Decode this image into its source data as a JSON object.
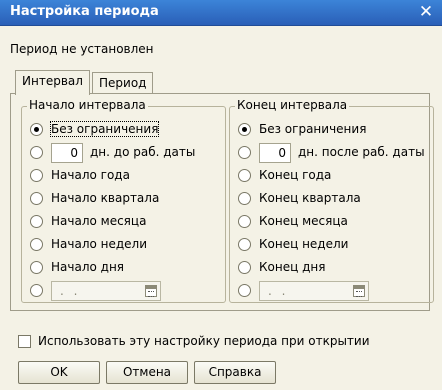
{
  "window": {
    "title": "Настройка периода",
    "close_symbol": "✕"
  },
  "status_text": "Период не установлен",
  "tabs": [
    {
      "label": "Интервал",
      "active": true
    },
    {
      "label": "Период",
      "active": false
    }
  ],
  "start_group": {
    "legend": "Начало интервала",
    "options": [
      {
        "label": "Без ограничения",
        "checked": true
      },
      {
        "label": "дн. до раб. даты",
        "checked": false,
        "number_value": "0"
      },
      {
        "label": "Начало года",
        "checked": false
      },
      {
        "label": "Начало квартала",
        "checked": false
      },
      {
        "label": "Начало месяца",
        "checked": false
      },
      {
        "label": "Начало недели",
        "checked": false
      },
      {
        "label": "Начало дня",
        "checked": false
      },
      {
        "date_placeholder": ". .",
        "checked": false
      }
    ]
  },
  "end_group": {
    "legend": "Конец интервала",
    "options": [
      {
        "label": "Без ограничения",
        "checked": true
      },
      {
        "label": "дн. после раб. даты",
        "checked": false,
        "number_value": "0"
      },
      {
        "label": "Конец года",
        "checked": false
      },
      {
        "label": "Конец квартала",
        "checked": false
      },
      {
        "label": "Конец месяца",
        "checked": false
      },
      {
        "label": "Конец недели",
        "checked": false
      },
      {
        "label": "Конец дня",
        "checked": false
      },
      {
        "date_placeholder": ". .",
        "checked": false
      }
    ]
  },
  "use_on_open": {
    "label": "Использовать эту настройку периода при открытии",
    "checked": false
  },
  "buttons": {
    "ok": "OK",
    "cancel": "Отмена",
    "help": "Справка"
  },
  "icons": {
    "calendar": "calendar-icon",
    "close": "close-icon"
  },
  "colors": {
    "titlebar": "#2a5fb7",
    "background": "#f4f2e6"
  }
}
